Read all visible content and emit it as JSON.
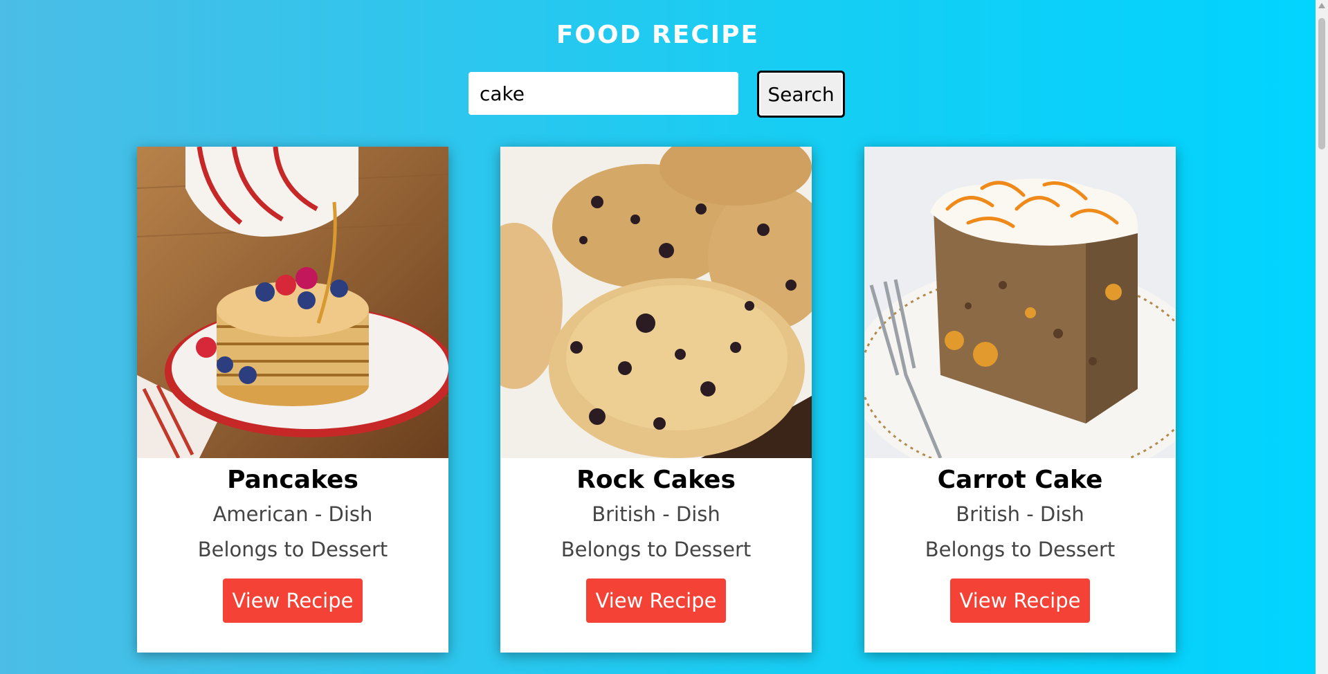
{
  "header": {
    "title": "FOOD RECIPE"
  },
  "search": {
    "value": "cake",
    "button_label": "Search"
  },
  "recipes": [
    {
      "name": "Pancakes",
      "area_line": "American - Dish",
      "category_line": "Belongs to Dessert",
      "button_label": "View Recipe",
      "image_icon": "pancakes-photo"
    },
    {
      "name": "Rock Cakes",
      "area_line": "British - Dish",
      "category_line": "Belongs to Dessert",
      "button_label": "View Recipe",
      "image_icon": "rock-cakes-photo"
    },
    {
      "name": "Carrot Cake",
      "area_line": "British - Dish",
      "category_line": "Belongs to Dessert",
      "button_label": "View Recipe",
      "image_icon": "carrot-cake-photo"
    }
  ],
  "colors": {
    "accent": "#f44336",
    "background_start": "#4bbde6",
    "background_end": "#00d4ff"
  }
}
